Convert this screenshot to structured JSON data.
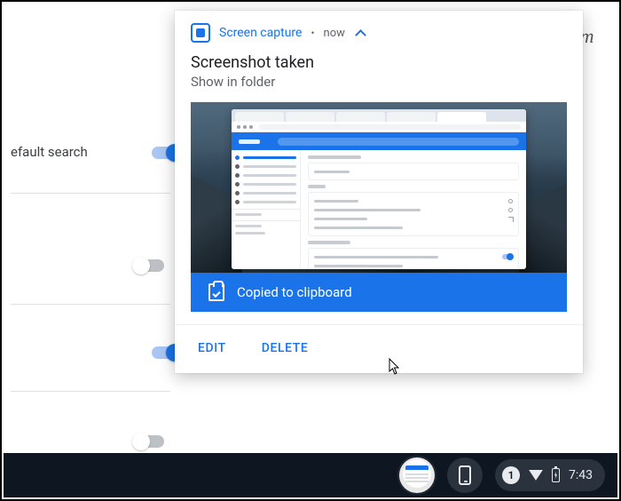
{
  "background": {
    "setting_label": "efault search"
  },
  "notification": {
    "app_name": "Screen capture",
    "separator": "•",
    "time": "now",
    "title": "Screenshot taken",
    "subtitle": "Show in folder",
    "clipboard_status": "Copied to clipboard",
    "actions": {
      "edit": "EDIT",
      "delete": "DELETE"
    }
  },
  "shelf": {
    "notif_count": "1",
    "clock": "7:43"
  },
  "watermark": "groovyPost.com"
}
